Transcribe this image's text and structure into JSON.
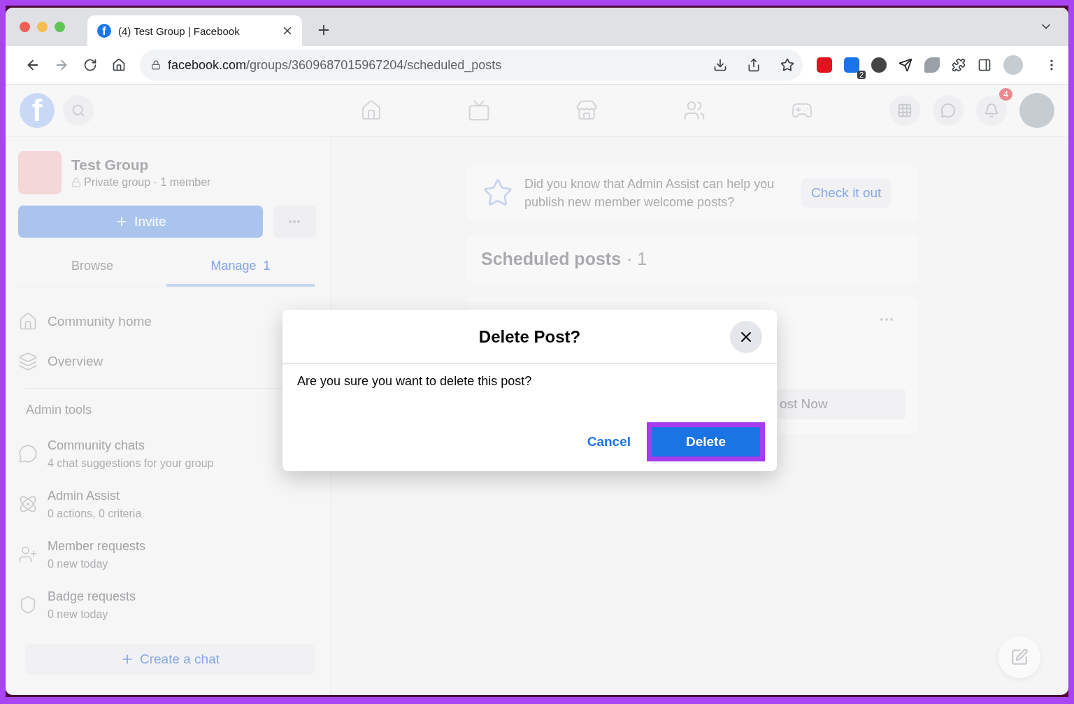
{
  "browser": {
    "favicon_letter": "f",
    "tab_title": "(4) Test Group | Facebook",
    "url_host": "facebook.com",
    "url_path": "/groups/3609687015967204/scheduled_posts",
    "extension_badge": "2"
  },
  "fb_header": {
    "logo_letter": "f",
    "notification_badge": "4"
  },
  "group": {
    "name": "Test Group",
    "meta": "Private group · 1 member",
    "invite_button": "Invite"
  },
  "tabs": [
    {
      "label": "Browse",
      "selected": false
    },
    {
      "label": "Manage",
      "count": "1",
      "selected": true
    }
  ],
  "nav_items": [
    {
      "label": "Community home"
    },
    {
      "label": "Overview"
    }
  ],
  "admin_tools": {
    "heading": "Admin tools",
    "items": [
      {
        "title": "Community chats",
        "subtitle": "4 chat suggestions for your group"
      },
      {
        "title": "Admin Assist",
        "subtitle": "0 actions, 0 criteria"
      },
      {
        "title": "Member requests",
        "subtitle": "0 new today"
      },
      {
        "title": "Badge requests",
        "subtitle": "0 new today"
      }
    ]
  },
  "create_chat_button": "Create a chat",
  "tip": {
    "text": "Did you know that Admin Assist can help you publish new member welcome posts?",
    "action": "Check it out"
  },
  "scheduled": {
    "title": "Scheduled posts",
    "count": "· 1"
  },
  "post_card": {
    "button": "ost Now"
  },
  "dialog": {
    "title": "Delete Post?",
    "message": "Are you sure you want to delete this post?",
    "cancel": "Cancel",
    "confirm": "Delete",
    "confirm_highlighted": true
  }
}
